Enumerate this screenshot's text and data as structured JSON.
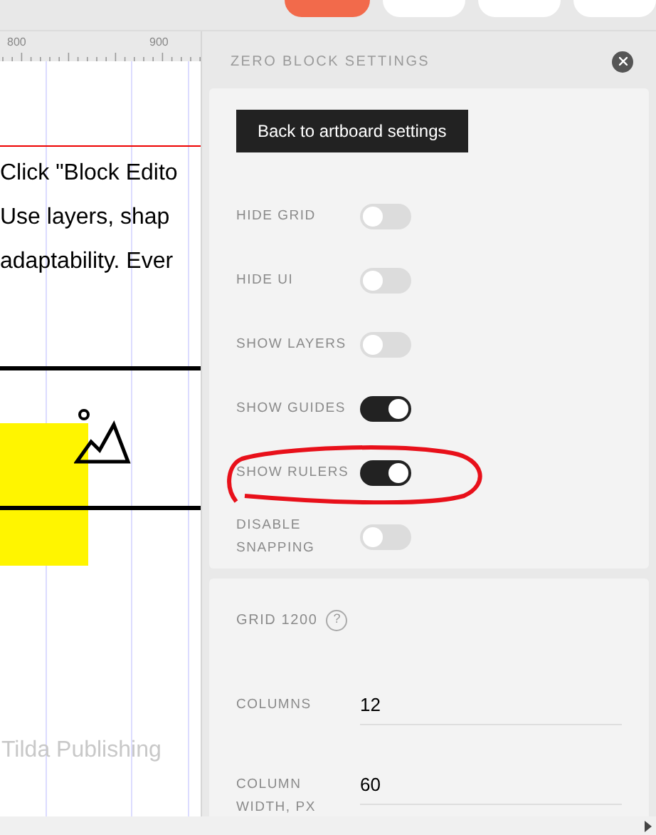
{
  "top_bar": {
    "buttons": [
      {
        "kind": "accent"
      },
      {
        "kind": "plain"
      },
      {
        "kind": "plain"
      },
      {
        "kind": "plain"
      }
    ]
  },
  "ruler": {
    "labels": [
      "800",
      "900"
    ]
  },
  "canvas": {
    "text_lines": [
      "Click \"Block Edito",
      "Use layers, shap",
      "adaptability. Ever"
    ],
    "footer_text": "Tilda Publishing"
  },
  "panel": {
    "title": "ZERO BLOCK SETTINGS",
    "back_button": "Back to artboard settings",
    "toggles": [
      {
        "label": "HIDE GRID",
        "on": false
      },
      {
        "label": "HIDE UI",
        "on": false
      },
      {
        "label": "SHOW LAYERS",
        "on": false
      },
      {
        "label": "SHOW GUIDES",
        "on": true
      },
      {
        "label": "SHOW RULERS",
        "on": true,
        "highlighted": true
      },
      {
        "label": "DISABLE SNAPPING",
        "on": false
      }
    ],
    "grid": {
      "title": "GRID 1200",
      "help": "?",
      "fields": [
        {
          "label": "COLUMNS",
          "value": "12"
        },
        {
          "label": "COLUMN WIDTH, PX",
          "value": "60"
        }
      ]
    }
  }
}
